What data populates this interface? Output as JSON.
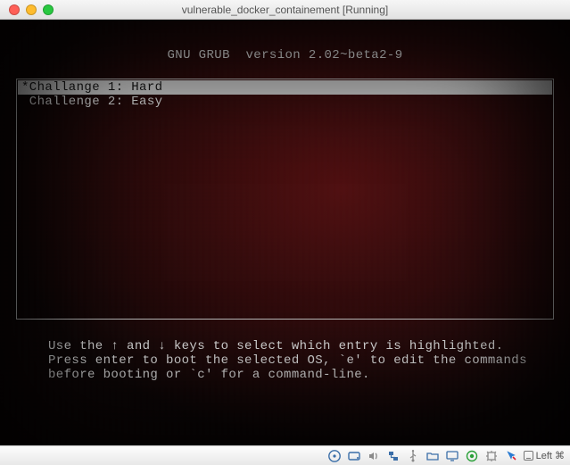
{
  "window": {
    "title": "vulnerable_docker_containement [Running]"
  },
  "grub": {
    "header": "GNU GRUB  version 2.02~beta2-9",
    "items": [
      {
        "label": "*Challange 1: Hard",
        "selected": true
      },
      {
        "label": " Challenge 2: Easy",
        "selected": false
      }
    ],
    "hint": "Use the ↑ and ↓ keys to select which entry is highlighted.\nPress enter to boot the selected OS, `e' to edit the commands\nbefore booting or `c' for a command-line."
  },
  "statusbar": {
    "host_key": "Left ⌘",
    "icons": [
      "disc-icon",
      "harddisk-icon",
      "audio-icon",
      "network-icon",
      "usb-icon",
      "shared-folders-icon",
      "display-icon",
      "recording-icon",
      "cpu-icon",
      "mouse-integration-icon"
    ],
    "colors": {
      "rec": "#2aa038",
      "icon": "#3a6ea8",
      "gray": "#8a8a8a"
    }
  }
}
